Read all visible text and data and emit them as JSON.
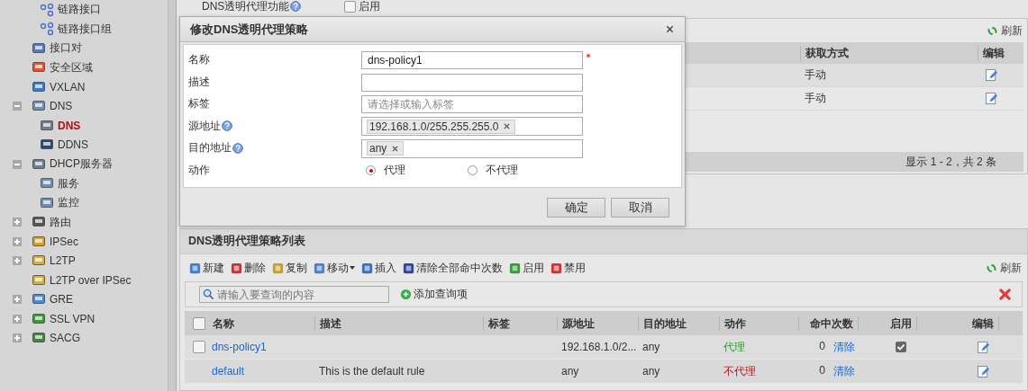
{
  "sidebar": {
    "continued_children": [
      {
        "label": "链路接口"
      },
      {
        "label": "链路接口组"
      }
    ],
    "items": [
      {
        "label": "接口对",
        "kind": "leaf",
        "selected": false
      },
      {
        "label": "安全区域",
        "kind": "leaf",
        "selected": false
      },
      {
        "label": "VXLAN",
        "kind": "leaf",
        "selected": false
      },
      {
        "label": "DNS",
        "kind": "folder",
        "expanded": true,
        "selected": false,
        "children": [
          {
            "label": "DNS",
            "selected": true
          },
          {
            "label": "DDNS",
            "selected": false
          }
        ]
      },
      {
        "label": "DHCP服务器",
        "kind": "folder",
        "expanded": true,
        "selected": false,
        "children": [
          {
            "label": "服务",
            "selected": false
          },
          {
            "label": "监控",
            "selected": false
          }
        ]
      },
      {
        "label": "路由",
        "kind": "folder",
        "expanded": false,
        "selected": false
      },
      {
        "label": "IPSec",
        "kind": "folder",
        "expanded": false,
        "selected": false
      },
      {
        "label": "L2TP",
        "kind": "folder",
        "expanded": false,
        "selected": false
      },
      {
        "label": "L2TP over IPSec",
        "kind": "leaf",
        "selected": false
      },
      {
        "label": "GRE",
        "kind": "folder",
        "expanded": false,
        "selected": false
      },
      {
        "label": "SSL VPN",
        "kind": "folder",
        "expanded": false,
        "selected": false
      },
      {
        "label": "SACG",
        "kind": "folder",
        "expanded": false,
        "selected": false
      }
    ]
  },
  "top_setting": {
    "label": "DNS透明代理功能",
    "checkbox_label": "启用",
    "checked": false
  },
  "background_panel": {
    "refresh": "刷新",
    "columns": [
      "获取方式",
      "编辑"
    ],
    "rows": [
      {
        "method": "手动"
      },
      {
        "method": "手动"
      }
    ],
    "footer": "显示 1 - 2，共 2 条"
  },
  "dialog": {
    "title": "修改DNS透明代理策略",
    "fields": [
      {
        "label": "名称",
        "kind": "text",
        "value": "dns-policy1",
        "required": true,
        "help": false
      },
      {
        "label": "描述",
        "kind": "text",
        "required": false,
        "help": false
      },
      {
        "label": "标签",
        "kind": "text",
        "placeholder": "请选择或输入标签",
        "required": false,
        "help": false
      },
      {
        "label": "源地址",
        "kind": "tags",
        "tags": [
          "192.168.1.0/255.255.255.0"
        ],
        "required": false,
        "help": true
      },
      {
        "label": "目的地址",
        "kind": "tags",
        "tags": [
          "any"
        ],
        "required": false,
        "help": true
      },
      {
        "label": "动作",
        "kind": "radio",
        "required": false,
        "help": false,
        "options": [
          {
            "label": "代理",
            "selected": true
          },
          {
            "label": "不代理",
            "selected": false
          }
        ]
      }
    ],
    "buttons": [
      "确定",
      "取消"
    ]
  },
  "policy_list": {
    "title": "DNS透明代理策略列表",
    "toolbar": [
      {
        "label": "新建",
        "dropdown": false
      },
      {
        "label": "删除",
        "dropdown": false
      },
      {
        "label": "复制",
        "dropdown": false
      },
      {
        "label": "移动",
        "dropdown": true
      },
      {
        "label": "插入",
        "dropdown": false
      },
      {
        "label": "清除全部命中次数",
        "dropdown": false
      },
      {
        "label": "启用",
        "dropdown": false
      },
      {
        "label": "禁用",
        "dropdown": false
      }
    ],
    "refresh": "刷新",
    "search": {
      "placeholder": "请输入要查询的内容"
    },
    "select_all_checked": false,
    "add_query": "添加查询项",
    "columns": [
      "名称",
      "描述",
      "标签",
      "源地址",
      "目的地址",
      "动作",
      "命中次数",
      "启用",
      "编辑"
    ],
    "rows": [
      {
        "checked": false,
        "name": "dns-policy1",
        "source": "192.168.1.0/2...",
        "destination": "any",
        "action": "代理",
        "kind": "proxy",
        "hits": "0",
        "clear": "清除",
        "enabled": true
      },
      {
        "name": "default",
        "description": "This is the default rule",
        "source": "any",
        "destination": "any",
        "action": "不代理",
        "kind": "no_proxy",
        "hits": "0",
        "clear": "清除"
      }
    ]
  }
}
